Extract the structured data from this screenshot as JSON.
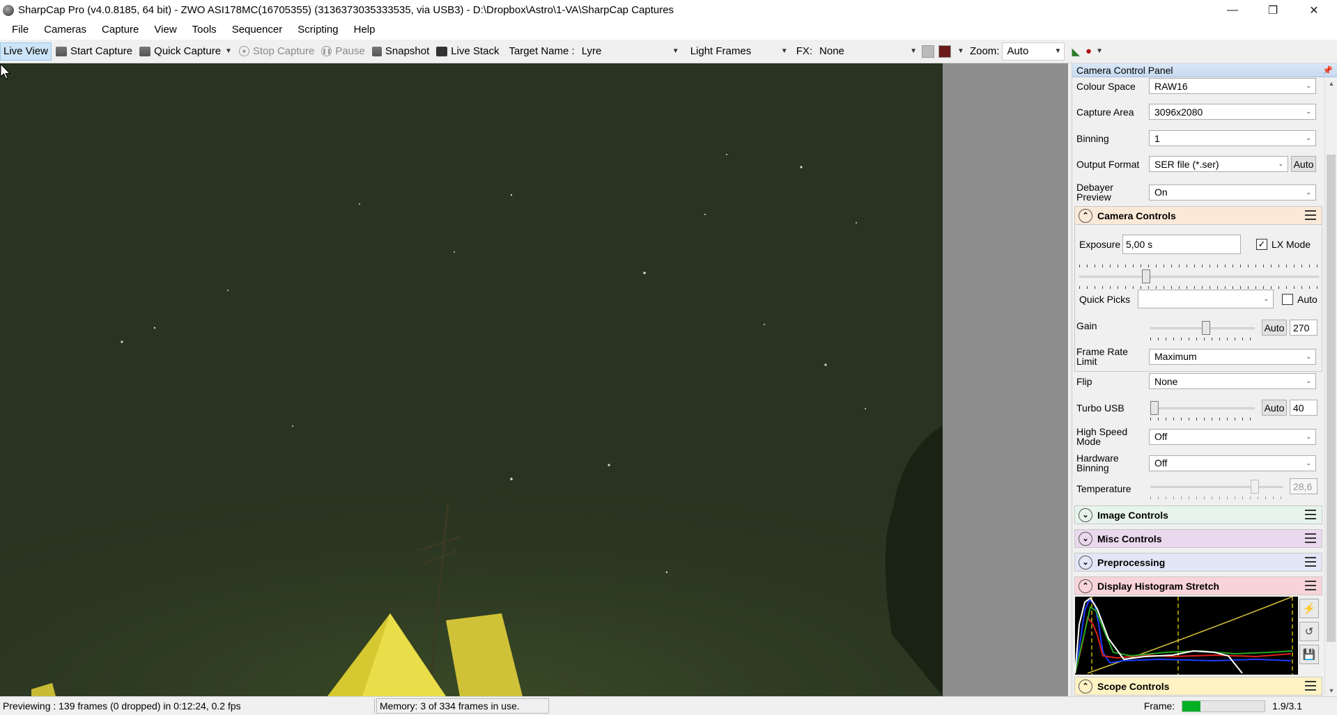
{
  "window": {
    "title": "SharpCap Pro (v4.0.8185, 64 bit) - ZWO ASI178MC(16705355) (3136373035333535, via USB3) - D:\\Dropbox\\Astro\\1-VA\\SharpCap Captures",
    "controls": {
      "minimize": "—",
      "restore": "❐",
      "close": "✕"
    }
  },
  "menu": [
    "File",
    "Cameras",
    "Capture",
    "View",
    "Tools",
    "Sequencer",
    "Scripting",
    "Help"
  ],
  "toolbar": {
    "live_view": "Live View",
    "start_capture": "Start Capture",
    "quick_capture": "Quick Capture",
    "stop_capture": "Stop Capture",
    "pause": "Pause",
    "snapshot": "Snapshot",
    "live_stack": "Live Stack",
    "target_label": "Target Name :",
    "target_value": "Lyre",
    "frame_type": "Light Frames",
    "fx_label": "FX:",
    "fx_value": "None",
    "zoom_label": "Zoom:",
    "zoom_value": "Auto"
  },
  "panel": {
    "title": "Camera Control Panel",
    "capture_format": {
      "colour_space_label": "Colour Space",
      "colour_space": "RAW16",
      "capture_area_label": "Capture Area",
      "capture_area": "3096x2080",
      "binning_label": "Binning",
      "binning": "1",
      "output_format_label": "Output Format",
      "output_format": "SER file (*.ser)",
      "output_auto": "Auto",
      "debayer_label": "Debayer Preview",
      "debayer": "On"
    },
    "camera_controls": {
      "title": "Camera Controls",
      "exposure_label": "Exposure",
      "exposure": "5,00 s",
      "lx_mode_label": "LX Mode",
      "lx_mode_checked": true,
      "quick_picks_label": "Quick Picks",
      "quick_picks_value": "",
      "quick_picks_auto": "Auto",
      "gain_label": "Gain",
      "gain_auto": "Auto",
      "gain": "270",
      "frame_rate_label": "Frame Rate Limit",
      "frame_rate": "Maximum",
      "flip_label": "Flip",
      "flip": "None",
      "turbo_label": "Turbo USB",
      "turbo_auto": "Auto",
      "turbo": "40",
      "high_speed_label": "High Speed Mode",
      "high_speed": "Off",
      "hw_binning_label": "Hardware Binning",
      "hw_binning": "Off",
      "temperature_label": "Temperature",
      "temperature": "28,6"
    },
    "sections": {
      "image_controls": "Image Controls",
      "misc_controls": "Misc Controls",
      "preprocessing": "Preprocessing",
      "histogram_stretch": "Display Histogram Stretch",
      "scope_controls": "Scope Controls"
    },
    "section_colors": {
      "camera": "#fbe9d7",
      "image": "#e6f4ec",
      "misc": "#ead8ee",
      "preprocessing": "#e3e6f6",
      "histogram": "#f8d3d8",
      "scope": "#fff3c4"
    }
  },
  "status": {
    "previewing": "Previewing : 139 frames (0 dropped) in 0:12:24, 0.2 fps",
    "memory": "Memory: 3 of 334 frames in use.",
    "frame_label": "Frame:",
    "frame_progress": 0.22,
    "frame_ratio": "1.9/3.1"
  }
}
